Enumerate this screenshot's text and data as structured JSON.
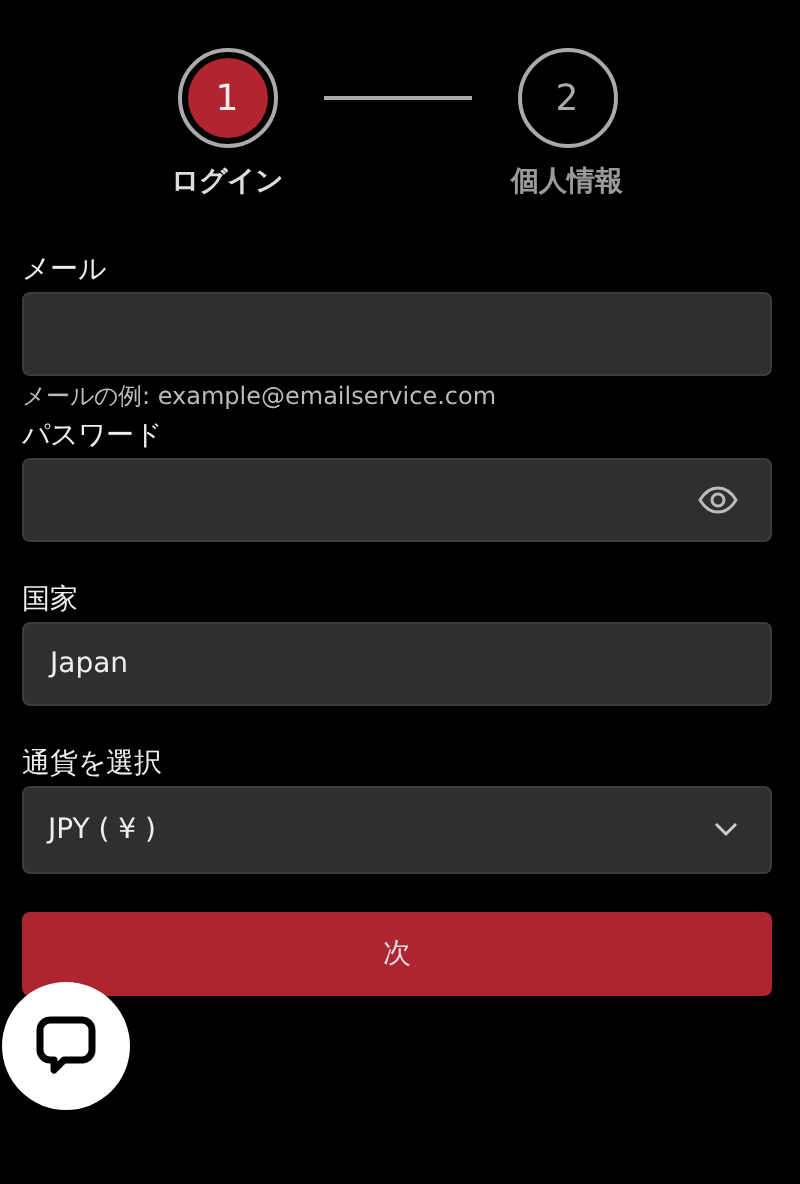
{
  "steps": [
    {
      "number": "1",
      "label": "ログイン",
      "selected": true
    },
    {
      "number": "2",
      "label": "個人情報",
      "selected": false
    }
  ],
  "fields": [
    {
      "kind": "text",
      "label": "メール",
      "hint": "メールの例: example@emailservice.com"
    },
    {
      "kind": "password",
      "label": "パスワード"
    },
    {
      "kind": "text",
      "label": "国家",
      "value": "Japan"
    },
    {
      "kind": "select",
      "label": "通貨を選択",
      "value": "JPY ( ¥ )"
    }
  ],
  "button": "次"
}
